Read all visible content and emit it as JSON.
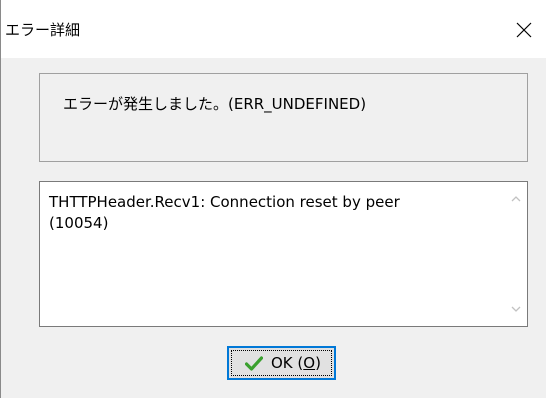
{
  "window": {
    "title": "エラー詳細",
    "close_icon": "close-icon"
  },
  "message": {
    "text": "エラーが発生しました。(ERR_UNDEFINED)"
  },
  "detail": {
    "text": "THTTPHeader.Recv1: Connection reset by peer\n(10054)",
    "scroll_up_icon": "chevron-up-icon",
    "scroll_down_icon": "chevron-down-icon"
  },
  "ok_button": {
    "label_prefix": "OK (",
    "mnemonic": "O",
    "label_suffix": ")",
    "icon": "checkmark-icon",
    "icon_color": "#3aa02e"
  }
}
